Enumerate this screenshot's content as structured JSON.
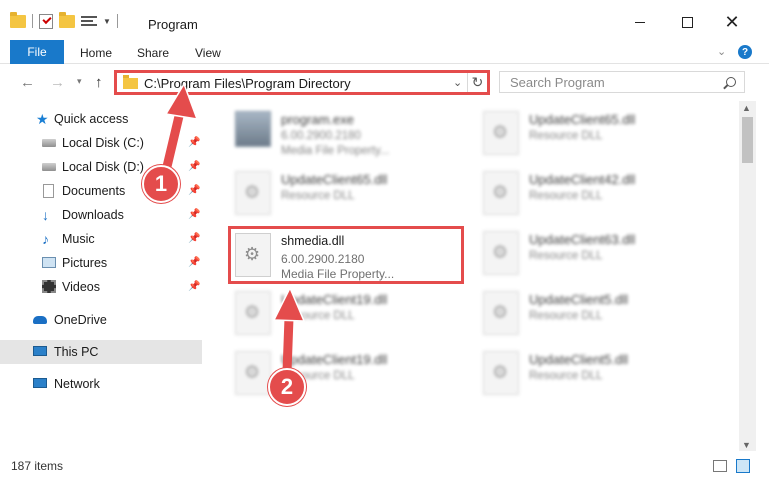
{
  "window": {
    "title": "Program",
    "close_glyph": "✕"
  },
  "ribbon": {
    "tabs": [
      {
        "label": "File"
      },
      {
        "label": "Home"
      },
      {
        "label": "Share"
      },
      {
        "label": "View"
      }
    ],
    "help_glyph": "?"
  },
  "address": {
    "path": "C:\\Program Files\\Program Directory",
    "search_placeholder": "Search Program"
  },
  "sidebar": {
    "items": [
      {
        "label": "Quick access",
        "icon": "star-icon"
      },
      {
        "label": "Local Disk (C:)",
        "icon": "disk-icon"
      },
      {
        "label": "Local Disk (D:)",
        "icon": "disk-icon"
      },
      {
        "label": "Documents",
        "icon": "documents-icon"
      },
      {
        "label": "Downloads",
        "icon": "download-icon"
      },
      {
        "label": "Music",
        "icon": "music-icon"
      },
      {
        "label": "Pictures",
        "icon": "pictures-icon"
      },
      {
        "label": "Videos",
        "icon": "videos-icon"
      },
      {
        "label": "OneDrive",
        "icon": "cloud-icon"
      },
      {
        "label": "This PC",
        "icon": "computer-icon",
        "selected": true
      },
      {
        "label": "Network",
        "icon": "network-icon"
      }
    ]
  },
  "files": {
    "items": [
      {
        "name": "program.exe",
        "line2": "6.00.2900.2180",
        "line3": "Media File Property..."
      },
      {
        "name": "UpdateClient65.dll",
        "line2": "Resource DLL",
        "line3": ""
      },
      {
        "name": "UpdateClient65.dll",
        "line2": "Resource DLL",
        "line3": ""
      },
      {
        "name": "UpdateClient42.dll",
        "line2": "Resource DLL",
        "line3": ""
      },
      {
        "name": "shmedia.dll",
        "line2": "6.00.2900.2180",
        "line3": "Media File Property..."
      },
      {
        "name": "UpdateClient63.dll",
        "line2": "Resource DLL",
        "line3": ""
      },
      {
        "name": "UpdateClient19.dll",
        "line2": "Resource DLL",
        "line3": ""
      },
      {
        "name": "UpdateClient5.dll",
        "line2": "Resource DLL",
        "line3": ""
      },
      {
        "name": "UpdateClient19.dll",
        "line2": "Resource DLL",
        "line3": ""
      },
      {
        "name": "UpdateClient5.dll",
        "line2": "Resource DLL",
        "line3": ""
      }
    ]
  },
  "status": {
    "count": "187 items"
  },
  "annotations": {
    "step1": "1",
    "step2": "2",
    "color": "#e44c4c"
  }
}
